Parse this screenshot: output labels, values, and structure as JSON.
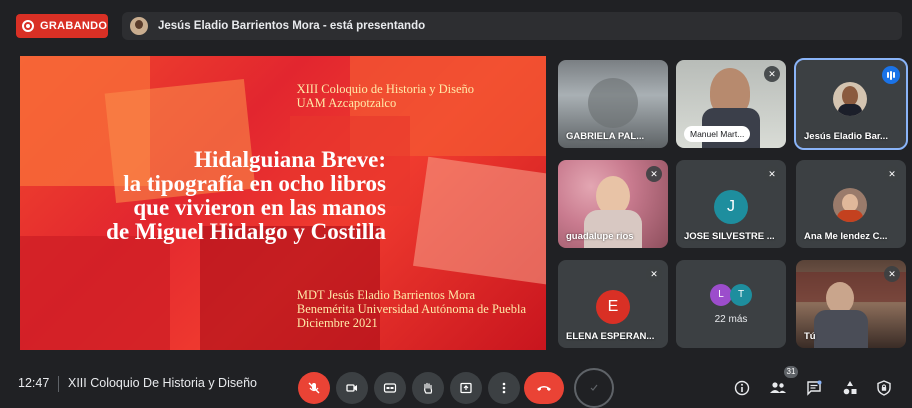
{
  "top_bar": {
    "recording_label": "GRABANDO",
    "presenting_text": "Jesús Eladio Barrientos Mora - está presentando"
  },
  "slide": {
    "conference_line1": "XIII Coloquio de Historia y Diseño",
    "conference_line2": "UAM Azcapotzalco",
    "title_line1": "Hidalguiana Breve:",
    "title_line2": "la tipografía en ocho libros",
    "title_line3": "que vivieron en las manos",
    "title_line4": "de Miguel Hidalgo y Costilla",
    "author_line1": "MDT Jesús Eladio Barrientos Mora",
    "author_line2": "Benemérita Universidad Autónoma de Puebla",
    "author_line3": "Diciembre 2021"
  },
  "participants": [
    {
      "name": "GABRIELA PAL...",
      "type": "video"
    },
    {
      "name": "Manuel Mart...",
      "type": "video"
    },
    {
      "name": "Jesús Eladio Bar...",
      "type": "avatar-photo"
    },
    {
      "name": "guadalupe rios",
      "type": "video"
    },
    {
      "name": "JOSE SILVESTRE ...",
      "initial": "J",
      "color": "#1e8e9e"
    },
    {
      "name": "Ana Me lendez C...",
      "type": "avatar-photo"
    },
    {
      "name": "ELENA ESPERAN...",
      "initial": "E",
      "color": "#d93025"
    },
    {
      "name": "22 más",
      "initial_a": "L",
      "initial_b": "T",
      "color_a": "#9c4dcc",
      "color_b": "#1e8e9e"
    },
    {
      "name": "Tú",
      "type": "video"
    }
  ],
  "bottom_bar": {
    "time": "12:47",
    "meeting_title": "XIII Coloquio De Historia y Diseño",
    "participant_count": "31"
  },
  "colors": {
    "accent_red": "#ea4335",
    "active_outline": "#8ab4f8",
    "tile_bg": "#3c4043"
  }
}
